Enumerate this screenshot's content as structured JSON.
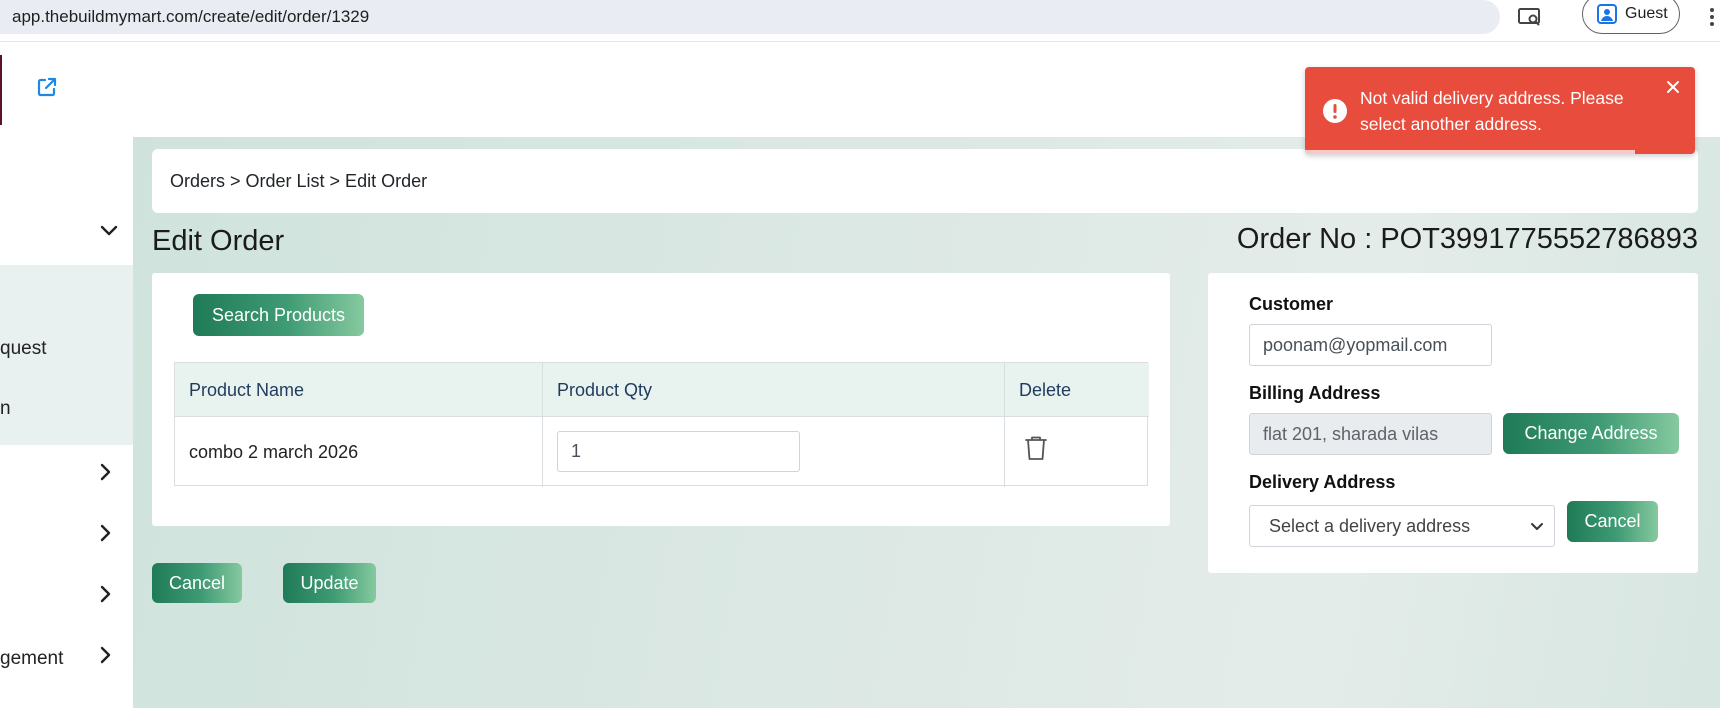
{
  "browser": {
    "url": "app.thebuildmymart.com/create/edit/order/1329",
    "profile_label": "Guest"
  },
  "sidebar": {
    "items": [
      {
        "label": "quest"
      },
      {
        "label": "n"
      },
      {
        "label": "gement"
      }
    ]
  },
  "breadcrumb": {
    "text": "Orders > Order List > Edit Order"
  },
  "page": {
    "title": "Edit Order",
    "order_no": "Order No : POT3991775552786893"
  },
  "products": {
    "search_label": "Search Products",
    "columns": [
      "Product Name",
      "Product Qty",
      "Delete"
    ],
    "rows": [
      {
        "name": "combo 2 march 2026",
        "qty": "1"
      }
    ]
  },
  "actions": {
    "cancel_label": "Cancel",
    "update_label": "Update"
  },
  "customer": {
    "customer_label": "Customer",
    "customer_value": "poonam@yopmail.com",
    "billing_label": "Billing Address",
    "billing_value": "flat 201, sharada vilas",
    "change_address_label": "Change Address",
    "delivery_label": "Delivery Address",
    "delivery_placeholder": "Select a delivery address",
    "cancel_label": "Cancel"
  },
  "toast": {
    "message": "Not valid delivery address. Please select another address.",
    "type": "error",
    "color": "#e74c3c"
  },
  "colors": {
    "accent_start": "#1f7a57",
    "accent_end": "#86c99f",
    "main_bg": "#d7e6e1",
    "table_header_bg": "#e8f2ef"
  }
}
